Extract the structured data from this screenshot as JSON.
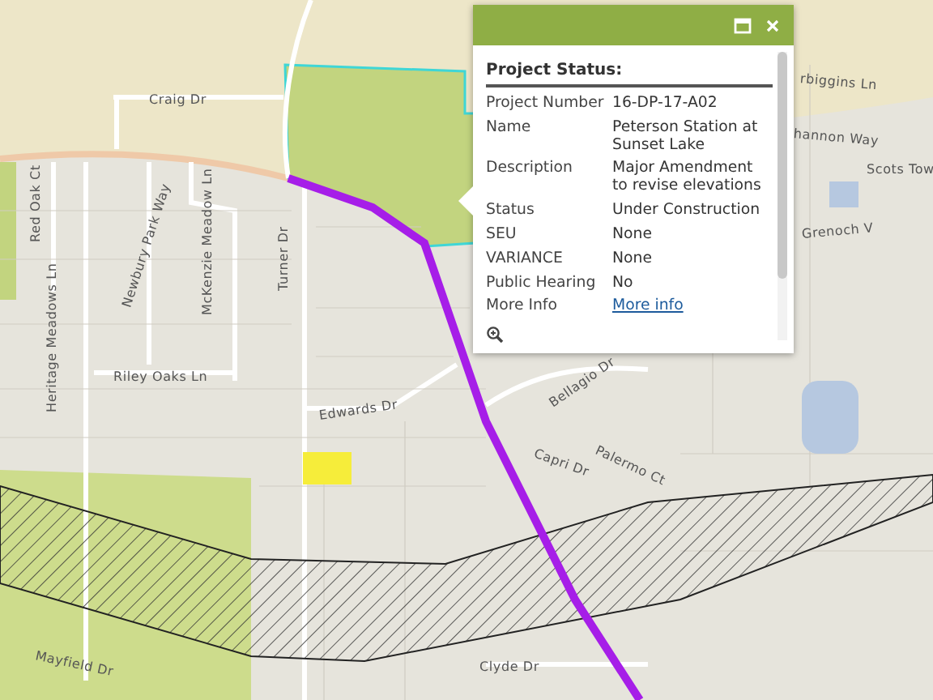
{
  "map": {
    "street_labels": [
      "Craig Dr",
      "Red Oak Ct",
      "Newbury Park Way",
      "McKenzie Meadow Ln",
      "Heritage Meadows Ln",
      "Riley Oaks Ln",
      "Turner Dr",
      "Edwards Dr",
      "Bellagio Dr",
      "Capri Dr",
      "Palermo Ct",
      "Clyde Dr",
      "Mayfield Dr",
      "rbiggins Ln",
      "hannon Way",
      "Scots Tow",
      "Grenoch V"
    ]
  },
  "popup": {
    "title": "Project Status:",
    "fields": [
      {
        "label": "Project Number",
        "value": "16-DP-17-A02",
        "kind": "text"
      },
      {
        "label": "Name",
        "value": "Peterson Station at Sunset Lake",
        "kind": "text"
      },
      {
        "label": "Description",
        "value": "Major Amendment to revise elevations",
        "kind": "text"
      },
      {
        "label": "Status",
        "value": "Under Construction",
        "kind": "text"
      },
      {
        "label": "SEU",
        "value": "None",
        "kind": "text"
      },
      {
        "label": "VARIANCE",
        "value": "None",
        "kind": "text"
      },
      {
        "label": "Public Hearing",
        "value": "No",
        "kind": "text"
      },
      {
        "label": "More Info",
        "value": "More info",
        "kind": "link"
      }
    ]
  }
}
